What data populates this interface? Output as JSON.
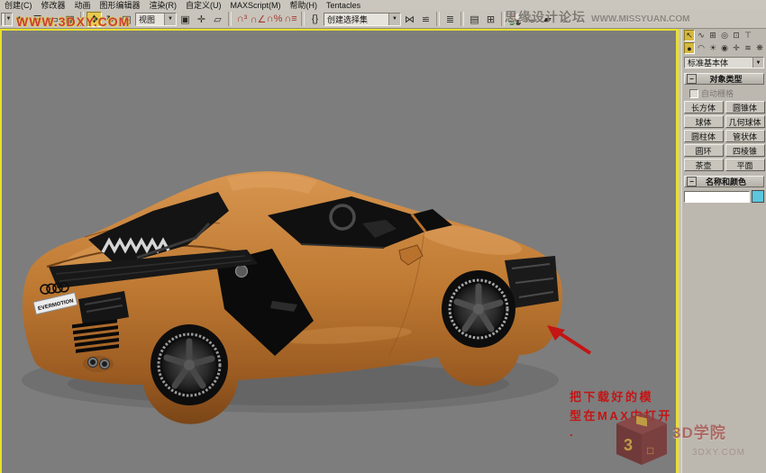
{
  "menu": {
    "items": [
      "创建(C)",
      "修改器",
      "动画",
      "图形编辑器",
      "渲染(R)",
      "自定义(U)",
      "MAXScript(M)",
      "帮助(H)",
      "Tentacles"
    ]
  },
  "toolbar": {
    "view_dropdown": "视图",
    "selection_set_dropdown": "创建选择集",
    "icons_left": [
      {
        "name": "select-object",
        "glyph": "↖"
      },
      {
        "name": "select-by-name",
        "glyph": "☰"
      },
      {
        "name": "rect-selection-region",
        "glyph": "▭"
      },
      {
        "name": "window-crossing",
        "glyph": "▦"
      },
      {
        "name": "separator",
        "sep": true
      },
      {
        "name": "select-and-move",
        "glyph": "✥",
        "active": true
      },
      {
        "name": "select-and-rotate",
        "glyph": "↻"
      },
      {
        "name": "select-and-scale",
        "glyph": "◳"
      }
    ],
    "icons_mid": [
      {
        "name": "use-pivot-point-center",
        "glyph": "▣"
      },
      {
        "name": "select-and-manipulate",
        "glyph": "✛"
      },
      {
        "name": "keyboard-override",
        "glyph": "▱"
      },
      {
        "name": "separator",
        "sep": true
      },
      {
        "name": "snap-toggle-3d",
        "glyph": "∩³",
        "color": "#a03a2e"
      },
      {
        "name": "angle-snap",
        "glyph": "∩∠",
        "color": "#a03a2e"
      },
      {
        "name": "percent-snap",
        "glyph": "∩%",
        "color": "#a03a2e"
      },
      {
        "name": "spinner-snap",
        "glyph": "∩≡",
        "color": "#a03a2e"
      },
      {
        "name": "separator",
        "sep": true
      },
      {
        "name": "named-selection-sets",
        "glyph": "{}"
      }
    ],
    "icons_right": [
      {
        "name": "mirror",
        "glyph": "⋈"
      },
      {
        "name": "align",
        "glyph": "≌"
      },
      {
        "name": "separator",
        "sep": true
      },
      {
        "name": "layer-manager",
        "glyph": "≣"
      },
      {
        "name": "separator",
        "sep": true
      },
      {
        "name": "curve-editor",
        "glyph": "▤"
      },
      {
        "name": "schematic-view",
        "glyph": "⊞"
      },
      {
        "name": "separator",
        "sep": true
      },
      {
        "name": "material-editor",
        "dots": [
          "#b63a30",
          "#e8e6e0",
          "#2f7d36",
          "#3f3d39"
        ]
      },
      {
        "name": "render-setup",
        "glyph": "☕"
      },
      {
        "name": "rendered-frame-window",
        "glyph": "▰"
      },
      {
        "name": "render-production",
        "glyph": "☕"
      }
    ]
  },
  "watermarks": {
    "top_left": "WWW.3DXY.COM",
    "top_right_cn": "思缘设计论坛",
    "top_right_en": "WWW.MISSYUAN.COM",
    "logo_title": "3D学院",
    "logo_sub": "3DXY.COM"
  },
  "annotation": {
    "line1": "把下载好的模",
    "line2": "型在MAX中打开",
    "line3": "."
  },
  "viewport": {
    "background": "#7d7d7d",
    "active_border": "#e9e02c",
    "model_description": "orange Audi R8 sports car, rear three-quarter view"
  },
  "car": {
    "plate": "EVERMOTION",
    "body_color": "#bf7a33"
  },
  "command_panel": {
    "tabs": [
      {
        "name": "create",
        "glyph": "↖",
        "active": true
      },
      {
        "name": "modify",
        "glyph": "∿"
      },
      {
        "name": "hierarchy",
        "glyph": "⊞"
      },
      {
        "name": "motion",
        "glyph": "◎"
      },
      {
        "name": "display",
        "glyph": "⊡"
      },
      {
        "name": "utilities",
        "glyph": "⊤"
      }
    ],
    "categories": [
      {
        "name": "geometry",
        "glyph": "●",
        "active": true
      },
      {
        "name": "shapes",
        "glyph": "◠"
      },
      {
        "name": "lights",
        "glyph": "☀"
      },
      {
        "name": "cameras",
        "glyph": "◉"
      },
      {
        "name": "helpers",
        "glyph": "✛"
      },
      {
        "name": "space-warps",
        "glyph": "≋"
      },
      {
        "name": "systems",
        "glyph": "❋"
      }
    ],
    "primitive_dropdown": "标准基本体",
    "rollout_object_type": "对象类型",
    "autogrid_label": "自动栅格",
    "primitive_buttons": [
      [
        "长方体",
        "圆锥体"
      ],
      [
        "球体",
        "几何球体"
      ],
      [
        "圆柱体",
        "管状体"
      ],
      [
        "圆环",
        "四棱锥"
      ],
      [
        "茶壶",
        "平面"
      ]
    ],
    "rollout_name_color": "名称和颜色",
    "name_field_value": ""
  }
}
